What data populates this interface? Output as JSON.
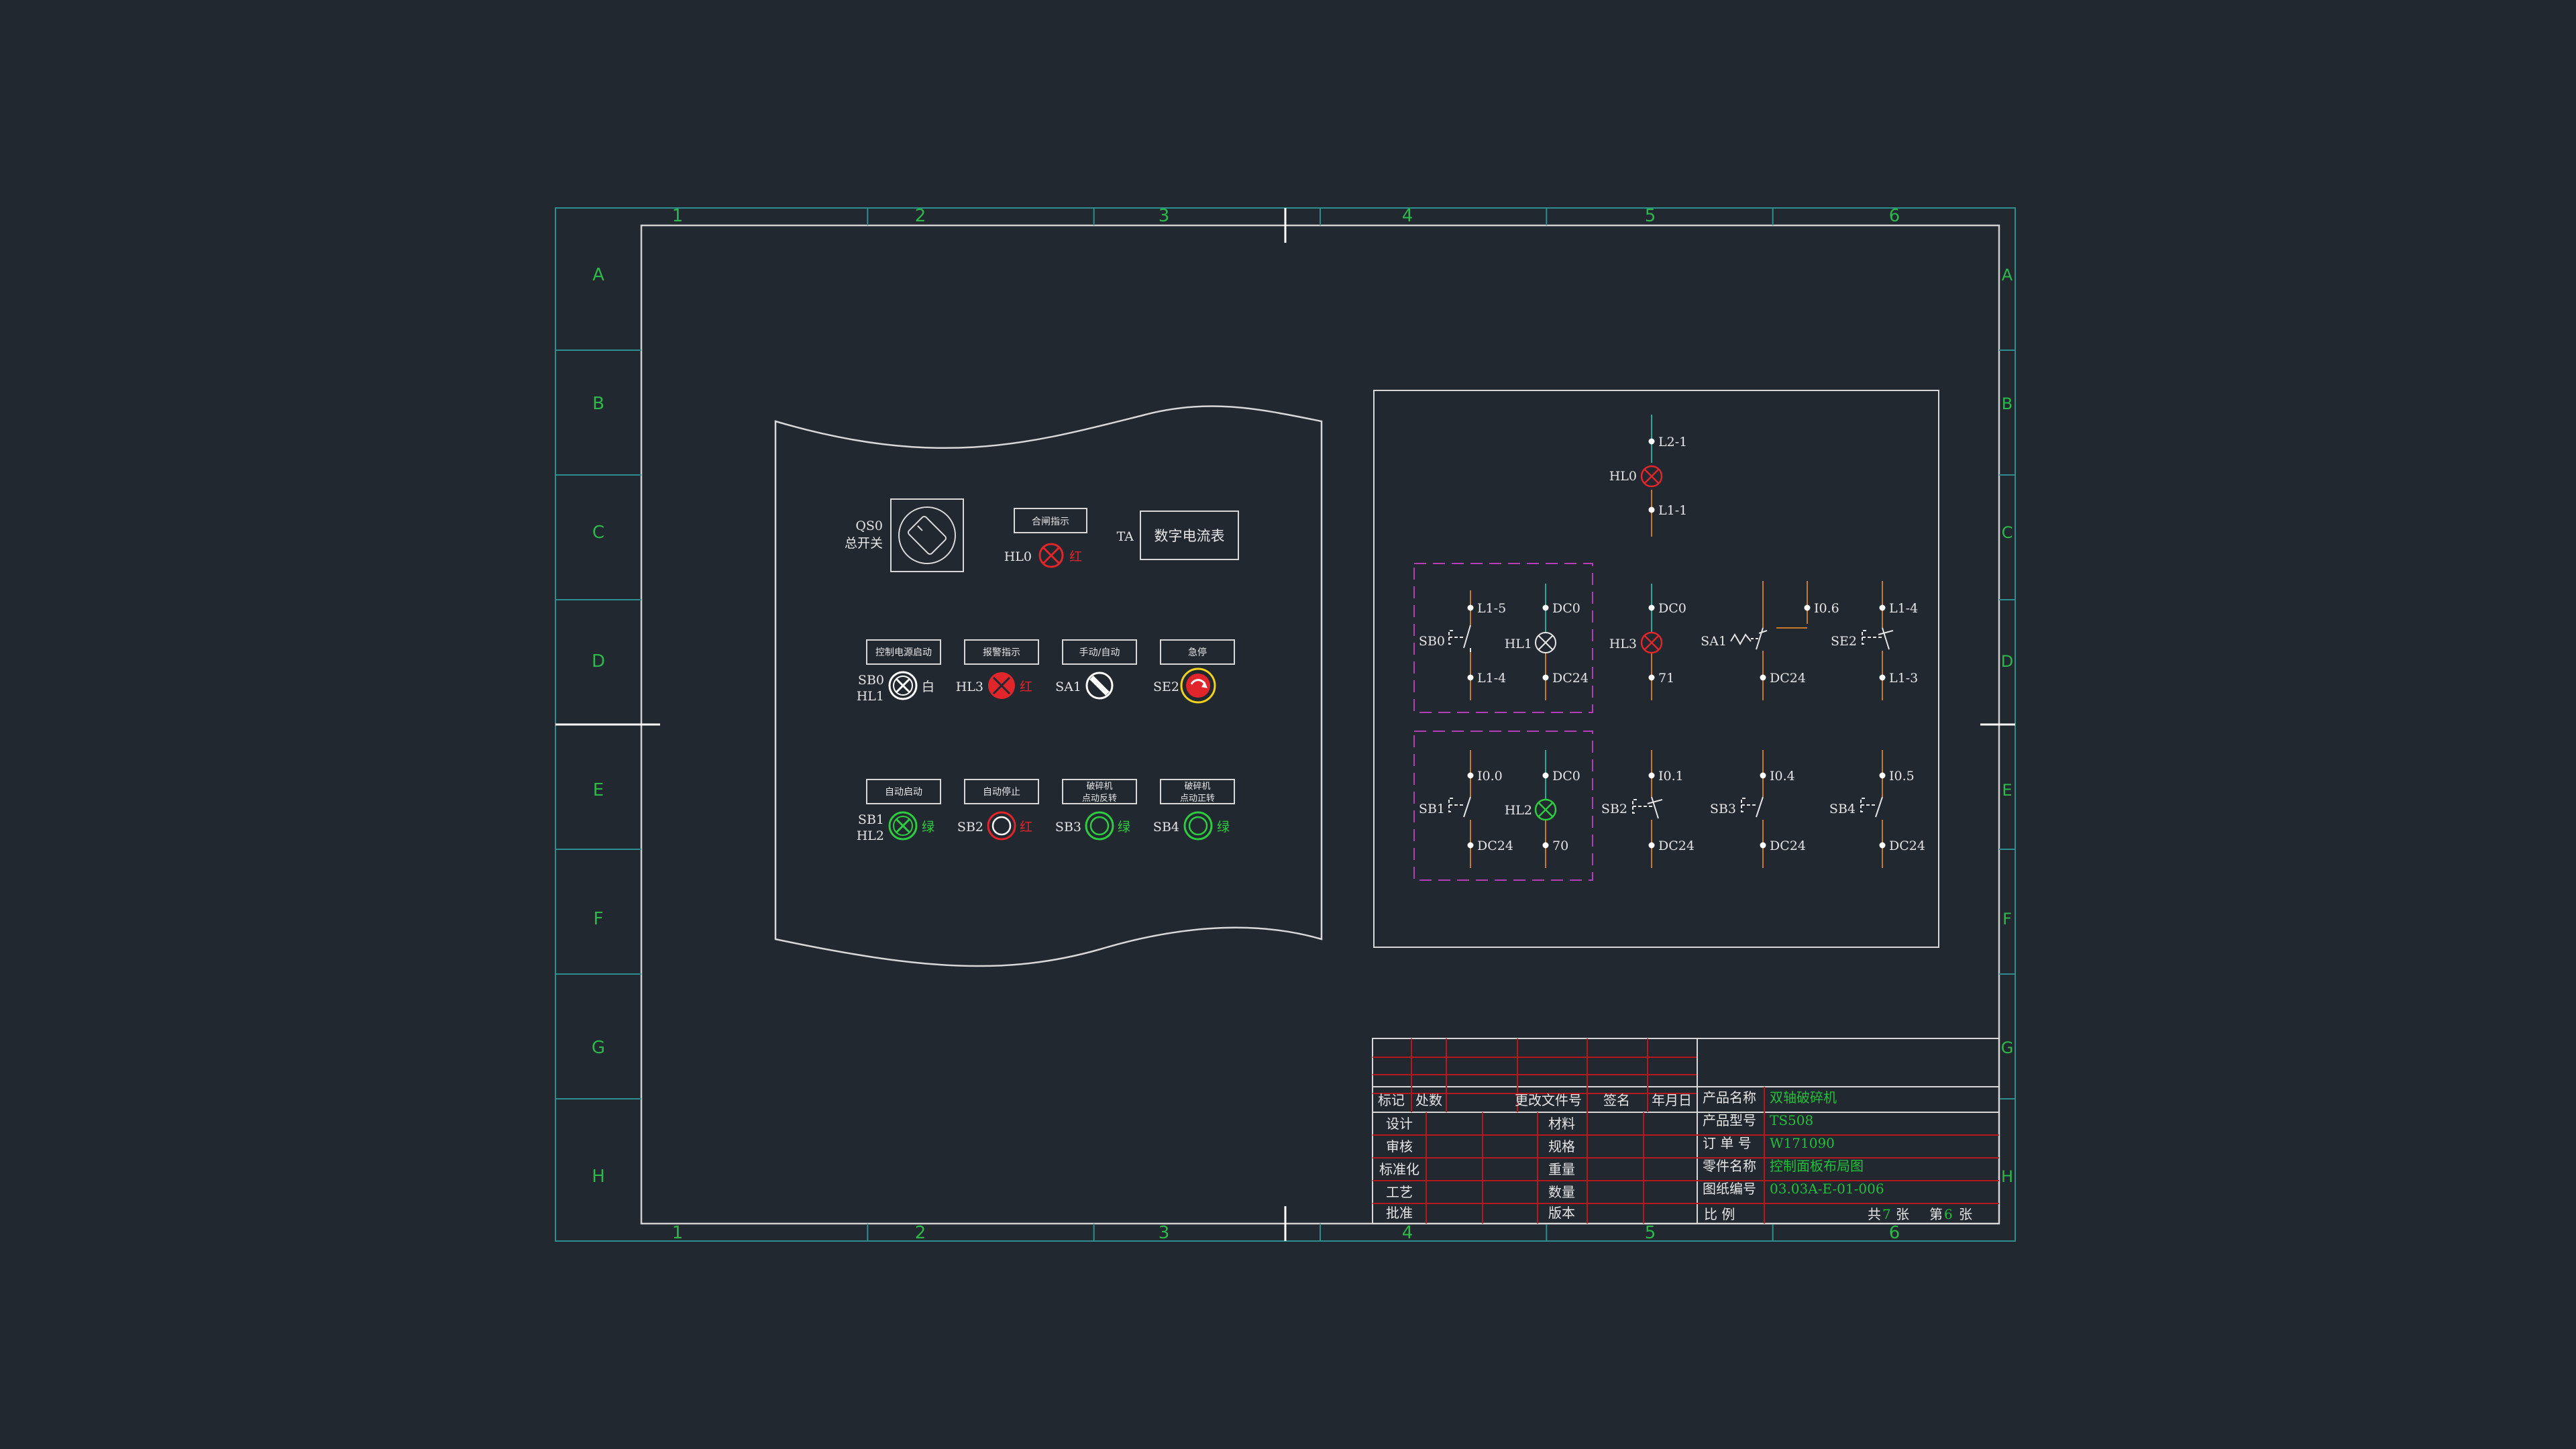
{
  "colors": {
    "background": "#212830",
    "frame_outer": "#2e8e8e",
    "frame_inner": "#d0d0d0",
    "zone_label": "#2db84a",
    "line_white": "#d8d8d8",
    "red": "#e0262a",
    "green": "#2ecc40",
    "yellow": "#f2d21b",
    "magenta": "#b23fb5",
    "wire_orange": "#c87a2c",
    "wire_teal": "#2aa79b",
    "table_red": "#b5191d",
    "table_value": "#22c03a"
  },
  "frame": {
    "columns": [
      "1",
      "2",
      "3",
      "4",
      "5",
      "6"
    ],
    "rows": [
      "A",
      "B",
      "C",
      "D",
      "E",
      "F",
      "G",
      "H"
    ]
  },
  "panel": {
    "qs0_label": "QS0",
    "qs0_name": "总开关",
    "hl0_plate": "合闸指示",
    "hl0_label": "HL0",
    "hl0_color": "红",
    "ta_label": "TA",
    "meter_label": "数字电流表",
    "row1": [
      {
        "plate": "控制电源启动",
        "label1": "SB0",
        "label2": "HL1",
        "color": "白",
        "icon": "white-lamp-button"
      },
      {
        "plate": "报警指示",
        "label1": "HL3",
        "label2": "",
        "color": "红",
        "icon": "red-lamp"
      },
      {
        "plate": "手动/自动",
        "label1": "SA1",
        "label2": "",
        "color": "",
        "icon": "selector-switch"
      },
      {
        "plate": "急停",
        "label1": "SE2",
        "label2": "",
        "color": "",
        "icon": "emergency-stop"
      }
    ],
    "row2": [
      {
        "plate": "自动启动",
        "plate2": "",
        "label1": "SB1",
        "label2": "HL2",
        "color": "绿",
        "icon": "green-lamp-button"
      },
      {
        "plate": "自动停止",
        "plate2": "",
        "label1": "SB2",
        "label2": "",
        "color": "红",
        "icon": "red-button"
      },
      {
        "plate": "破碎机",
        "plate2": "点动反转",
        "label1": "SB3",
        "label2": "",
        "color": "绿",
        "icon": "green-button"
      },
      {
        "plate": "破碎机",
        "plate2": "点动正转",
        "label1": "SB4",
        "label2": "",
        "color": "绿",
        "icon": "green-button"
      }
    ]
  },
  "schematic": {
    "top": {
      "top": "L2-1",
      "lamp": "HL0",
      "bottom": "L1-1"
    },
    "row1": [
      {
        "element": "SB0",
        "top": "L1-5",
        "bottom": "L1-4"
      },
      {
        "element": "HL1",
        "top": "DC0",
        "bottom": "DC24"
      },
      {
        "element": "HL3",
        "top": "DC0",
        "bottom": "71"
      },
      {
        "element": "SA1",
        "top": "I0.6",
        "bottom": "DC24"
      },
      {
        "element": "SE2",
        "top": "L1-4",
        "bottom": "L1-3"
      }
    ],
    "row2": [
      {
        "element": "SB1",
        "top": "I0.0",
        "bottom": "DC24"
      },
      {
        "element": "HL2",
        "top": "DC0",
        "bottom": "70"
      },
      {
        "element": "SB2",
        "top": "I0.1",
        "bottom": "DC24"
      },
      {
        "element": "SB3",
        "top": "I0.4",
        "bottom": "DC24"
      },
      {
        "element": "SB4",
        "top": "I0.5",
        "bottom": "DC24"
      }
    ]
  },
  "title_block": {
    "revision_headers": [
      "标记",
      "处数",
      "更改文件号",
      "签名",
      "年月日"
    ],
    "left_labels": [
      "设计",
      "审核",
      "标准化",
      "工艺",
      "批准"
    ],
    "mid_labels": [
      "材料",
      "规格",
      "重量",
      "数量",
      "版本"
    ],
    "fields": [
      {
        "label": "产品名称",
        "value": "双轴破碎机"
      },
      {
        "label": "产品型号",
        "value": "TS508"
      },
      {
        "label": "订 单 号",
        "value": "W171090"
      },
      {
        "label": "零件名称",
        "value": "控制面板布局图"
      },
      {
        "label": "图纸编号",
        "value": "03.03A-E-01-006"
      }
    ],
    "scale_label": "比  例",
    "sheets_total_prefix": "共",
    "sheets_total": "7",
    "sheets_total_suffix": "张",
    "sheet_no_prefix": "第",
    "sheet_no": "6",
    "sheet_no_suffix": "张"
  }
}
